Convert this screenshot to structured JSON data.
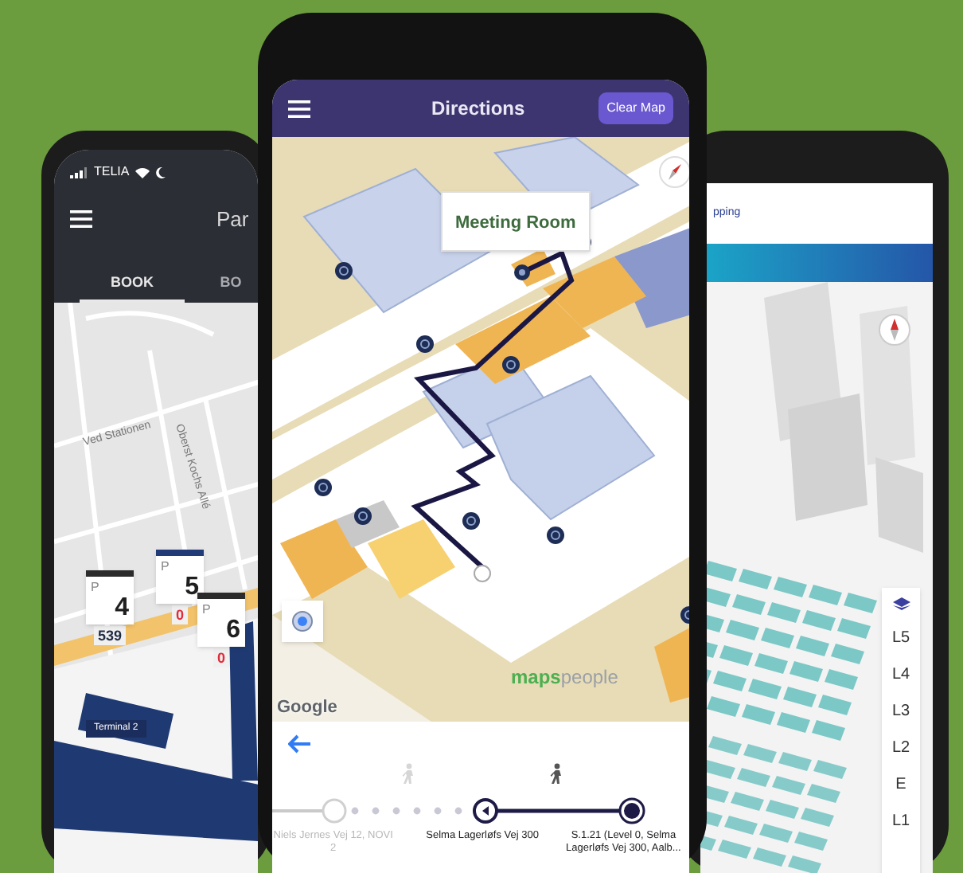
{
  "left_phone": {
    "status_bar": {
      "carrier": "TELIA"
    },
    "title": "Par",
    "tabs": [
      {
        "label": "BOOK",
        "selected": true
      },
      {
        "label": "BO",
        "selected": false
      }
    ],
    "map": {
      "street_labels": [
        "Ved Stationen",
        "Oberst Kochs Allé"
      ],
      "parking_markers": [
        {
          "letter": "P",
          "number": "4",
          "count": "539",
          "kind": "open"
        },
        {
          "letter": "P",
          "number": "5",
          "count": "0",
          "kind": "full"
        },
        {
          "letter": "P",
          "number": "6",
          "count": "0",
          "kind": "full"
        }
      ],
      "area_label": "Terminal 2"
    }
  },
  "right_phone": {
    "header_text": "pping",
    "levels": [
      "L5",
      "L4",
      "L3",
      "L2",
      "E",
      "L1"
    ]
  },
  "middle_phone": {
    "header": {
      "title": "Directions",
      "button": "Clear Map"
    },
    "map": {
      "popup": "Meeting Room",
      "logo": [
        "maps",
        "people"
      ],
      "attribution": "Google"
    },
    "route_steps": [
      {
        "label": "Niels Jernes Vej 12, NOVI 2",
        "kind": "past"
      },
      {
        "label": "Selma Lagerløfs Vej 300",
        "kind": "current"
      },
      {
        "label": "S.1.21 (Level 0, Selma Lagerløfs Vej 300, Aalb...",
        "kind": "destination"
      }
    ]
  }
}
